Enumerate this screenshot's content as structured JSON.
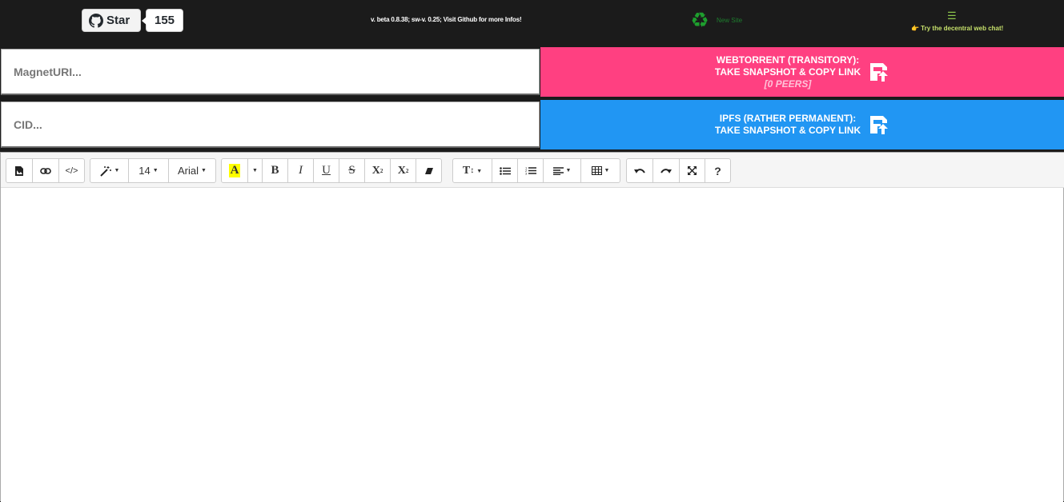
{
  "github": {
    "star_label": "Star",
    "star_count": "155"
  },
  "header": {
    "version_text": "v. beta 0.8.38; sw-v. 0.25; Visit Github for more Infos!",
    "new_site_label": "New Site",
    "chat_menu_glyph": "☰",
    "chat_link_text": "👉 Try the decentral web chat!"
  },
  "magnet": {
    "placeholder": "MagnetURI..."
  },
  "webtorrent_button": {
    "line1": "WEBTORRENT (TRANSITORY):",
    "line2": "TAKE SNAPSHOT & COPY LINK",
    "peers": "[0 PEERS]"
  },
  "cid": {
    "placeholder": "CID..."
  },
  "ipfs_button": {
    "line1": "IPFS (RATHER PERMANENT):",
    "line2": "TAKE SNAPSHOT & COPY LINK"
  },
  "toolbar": {
    "font_size": "14",
    "font_name": "Arial",
    "help": "?"
  },
  "colors": {
    "webtorrent": "#ff4081",
    "ipfs": "#2196f3",
    "background": "#1b1b1b"
  }
}
